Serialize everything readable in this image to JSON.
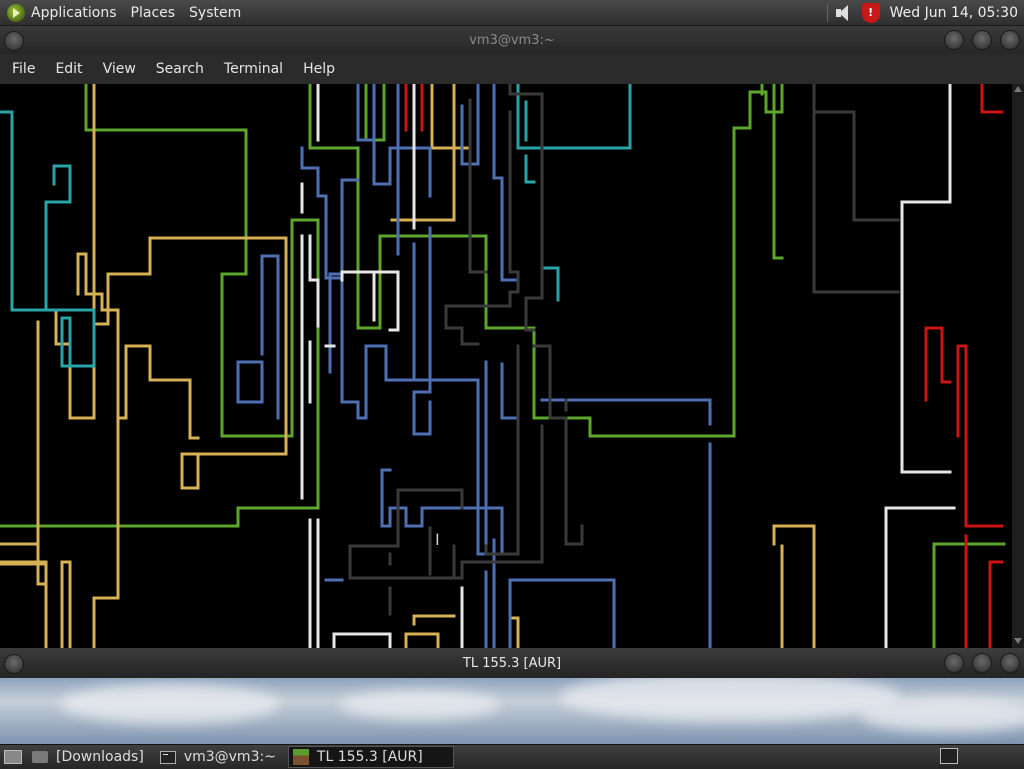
{
  "top_panel": {
    "menus": [
      "Applications",
      "Places",
      "System"
    ],
    "clock": "Wed Jun 14, 05:30",
    "shield_glyph": "!"
  },
  "terminal_window": {
    "title": "vm3@vm3:~",
    "menus": [
      "File",
      "Edit",
      "View",
      "Search",
      "Terminal",
      "Help"
    ],
    "background": "#000000",
    "pipe_colors": {
      "green": "#5ea52e",
      "yellow": "#d6b156",
      "blue": "#4f6fb3",
      "cyan": "#2aa4a8",
      "white": "#e6e6e6",
      "gray": "#3a3a3a",
      "red": "#cc1414"
    }
  },
  "game_window": {
    "title": "TL 155.3 [AUR]"
  },
  "taskbar": {
    "tasks": [
      {
        "label": "[Downloads]",
        "icon": "folder-icon"
      },
      {
        "label": "vm3@vm3:~",
        "icon": "terminal-icon"
      },
      {
        "label": "TL 155.3 [AUR]",
        "icon": "minecraft-icon",
        "active": true
      }
    ]
  }
}
